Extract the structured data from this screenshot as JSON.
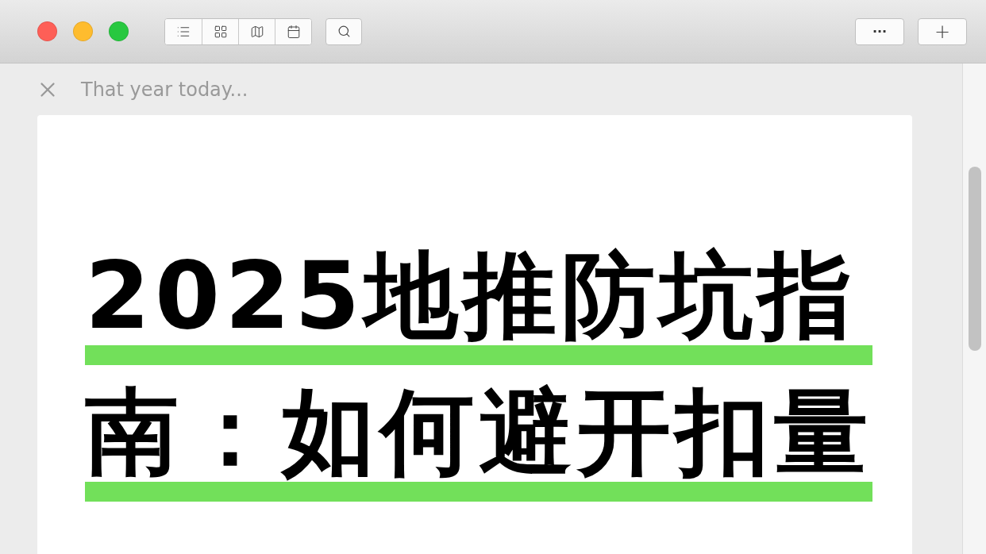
{
  "toolbar": {
    "view_buttons": [
      {
        "kind": "list"
      },
      {
        "kind": "grid"
      },
      {
        "kind": "map"
      },
      {
        "kind": "calendar"
      }
    ],
    "more_label": "···",
    "add_label": "+"
  },
  "header": {
    "title": "That year today..."
  },
  "cover": {
    "lines": [
      "2025地推防坑指",
      "南：如何避开扣量"
    ]
  }
}
